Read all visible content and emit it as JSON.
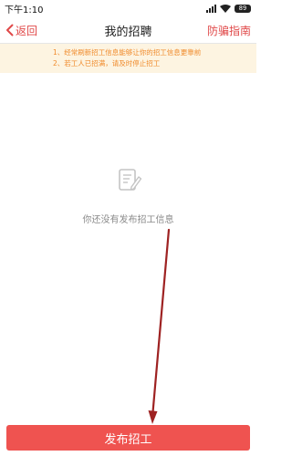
{
  "status_bar": {
    "time": "下午1:10",
    "battery": "89"
  },
  "nav": {
    "back_label": "返回",
    "title": "我的招聘",
    "guide_label": "防骗指南",
    "accent_color": "#e04848"
  },
  "tips": [
    "1、经常刷新招工信息能够让你的招工信息更靠前",
    "2、若工人已招满，请及时停止招工"
  ],
  "empty_state": {
    "icon": "edit-document-icon",
    "message": "你还没有发布招工信息"
  },
  "post_button": {
    "label": "发布招工",
    "color": "#ef5350"
  }
}
